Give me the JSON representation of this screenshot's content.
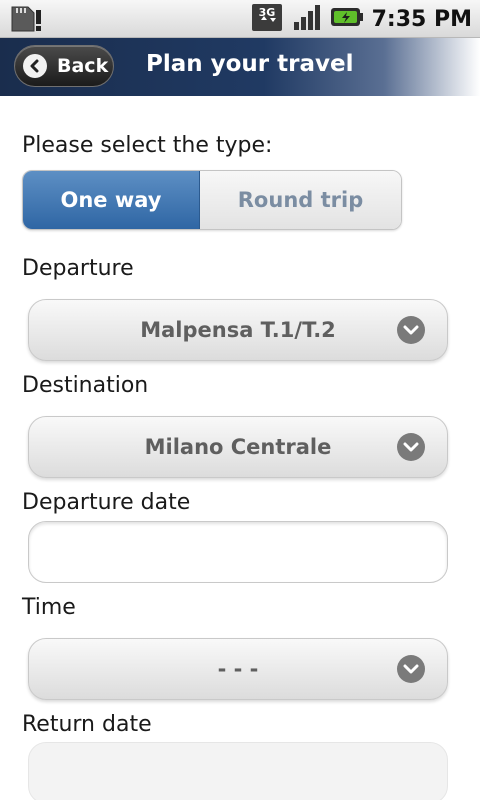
{
  "status_bar": {
    "time": "7:35 PM",
    "icons": [
      "sd-card-alert-icon",
      "3g-data-icon",
      "signal-icon",
      "battery-charging-icon"
    ],
    "network_label": "3G"
  },
  "header": {
    "back_label": "Back",
    "title": "Plan your travel"
  },
  "form": {
    "type_label": "Please select the type:",
    "type_options": [
      "One way",
      "Round trip"
    ],
    "type_selected": "One way",
    "departure_label": "Departure",
    "departure_value": "Malpensa T.1/T.2",
    "destination_label": "Destination",
    "destination_value": "Milano Centrale",
    "departure_date_label": "Departure date",
    "departure_date_value": "",
    "time_label": "Time",
    "time_value": "- - -",
    "return_date_label": "Return date",
    "return_date_value": ""
  },
  "colors": {
    "header_dark": "#1a2d4d",
    "segment_active": "#2f66a4",
    "segment_inactive_text": "#7b8da2"
  }
}
